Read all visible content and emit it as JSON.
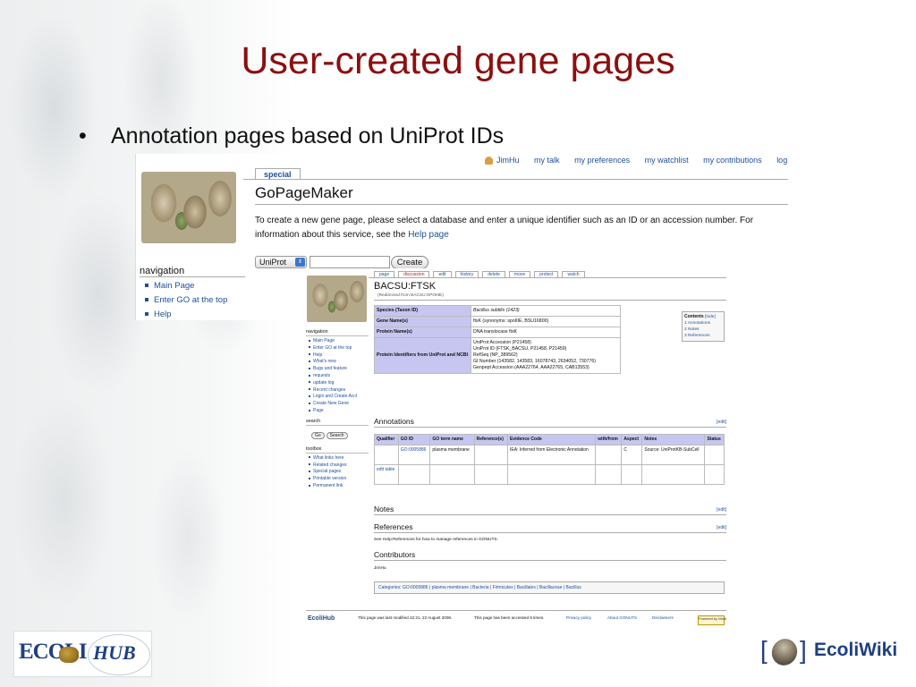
{
  "slide": {
    "title": "User-created gene pages",
    "bullet": "Annotation pages based on UniProt IDs"
  },
  "gopagemaker": {
    "top_links": [
      "JimHu",
      "my talk",
      "my preferences",
      "my watchlist",
      "my contributions",
      "log out"
    ],
    "tab": "special",
    "title": "GoPageMaker",
    "desc_1": "To create a new gene page, please select a database and enter a unique identifier such as an ID or an accession number. For information about this service, see the ",
    "help_link": "Help page",
    "nav_heading": "navigation",
    "nav_items": [
      "Main Page",
      "Enter GO at the top",
      "Help"
    ],
    "db_select": "UniProt",
    "id_value": "",
    "create_label": "Create"
  },
  "genepage": {
    "tabs": [
      "page",
      "discussion",
      "edit",
      "history",
      "delete",
      "move",
      "protect",
      "watch"
    ],
    "title": "BACSU:FTSK",
    "redirect": "(Redirected from BACSU:SPOIIIE)",
    "nav_heading": "navigation",
    "nav_items": [
      "Main Page",
      "Enter GO at the top",
      "Help",
      "What's new",
      "Bugs and feature",
      "requests",
      "update log",
      "Recent changes",
      "Login and Create Acct",
      "Create New Gene",
      "Page"
    ],
    "search_heading": "search",
    "go_btn": "Go",
    "search_btn": "Search",
    "toolbox_heading": "toolbox",
    "toolbox_items": [
      "What links here",
      "Related changes",
      "Special pages",
      "Printable version",
      "Permanent link"
    ],
    "info_rows": [
      {
        "label": "Species (Taxon ID)",
        "value": "Bacillus subtilis (1423)"
      },
      {
        "label": "Gene Name(s)",
        "value": "ftsK (synonyms: spoIIIE, BSU16800)"
      },
      {
        "label": "Protein Name(s)",
        "value": "DNA translocase ftsK"
      },
      {
        "label": "Protein Identifiers from UniProt and NCBI",
        "lines": [
          "UniProt Accession (P21458)",
          "UniProt ID (FTSK_BACSU, P21458, P21459)",
          "RefSeq (NP_389562)",
          "GI Number (143582, 143583, 16078743, 2634052, 730776)",
          "Genpept Accession (AAA22764, AAA22765, CAB13553)"
        ]
      }
    ],
    "toc": {
      "title": "Contents",
      "hide": "[hide]",
      "items": [
        "1 Annotations",
        "2 Notes",
        "3 References"
      ]
    },
    "annotations_heading": "Annotations",
    "edit_link": "[edit]",
    "ann_headers": [
      "Qualifier",
      "GO ID",
      "GO term name",
      "Reference(s)",
      "Evidence Code",
      "with/from",
      "Aspect",
      "Notes",
      "Status"
    ],
    "ann_row": [
      "",
      "GO:0005886",
      "plasma membrane",
      "",
      "IEA: Inferred from Electronic Annotation",
      "",
      "C",
      "Source: UniProtKB-SubCell",
      ""
    ],
    "edit_table": "edit table",
    "notes_heading": "Notes",
    "references_heading": "References",
    "ref_text": "See Help:References for how to manage references in GONUTS.",
    "contributors_heading": "Contributors",
    "contributor": "JimHu",
    "categories": "Categories: GO:0005886 | plasma membrane | Bacteria | Firmicutes | Bacillales | Bacillaceae | Bacillus",
    "footer_logo": "EcoliHub",
    "footer_modified": "This page was last modified 22:21, 22 August 2008.",
    "footer_accessed": "This page has been accessed 9 times.",
    "footer_privacy": "Privacy policy",
    "footer_about": "About GONUTS",
    "footer_disclaimers": "Disclaimers",
    "footer_powered": "Powered by MediaWiki"
  },
  "logos": {
    "ecolihub_a": "ECOLI",
    "ecolihub_b": "HUB",
    "ecoliwiki": "EcoliWiki"
  }
}
